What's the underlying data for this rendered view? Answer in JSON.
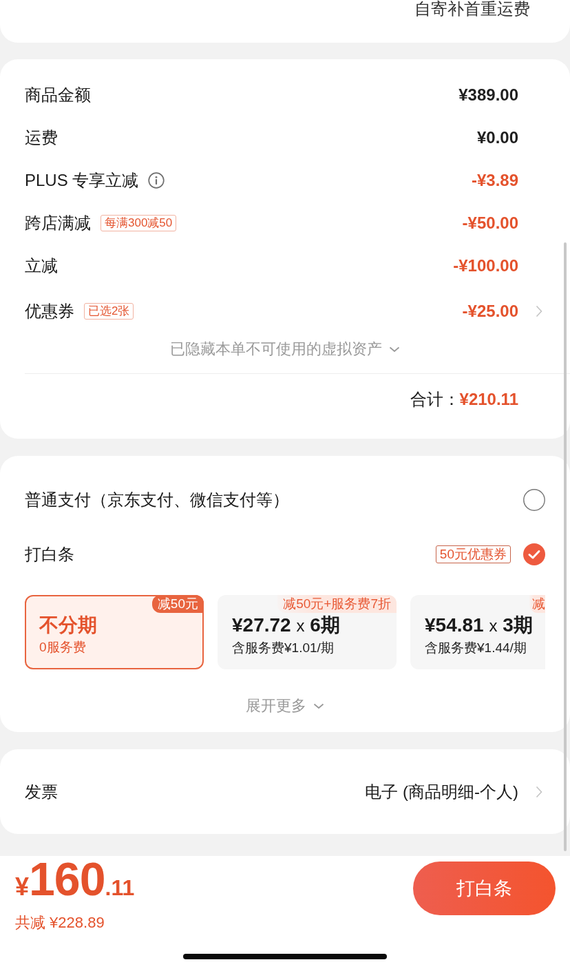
{
  "shipping_note": {
    "text": "自寄补首重运费"
  },
  "summary": {
    "rows": [
      {
        "label": "商品金额",
        "value": "¥389.00",
        "discount": false
      },
      {
        "label": "运费",
        "value": "¥0.00",
        "discount": false
      },
      {
        "label": "PLUS 专享立减",
        "value": "-¥3.89",
        "discount": true,
        "info_icon": true
      },
      {
        "label": "跨店满减",
        "tag": "每满300减50",
        "value": "-¥50.00",
        "discount": true
      },
      {
        "label": "立减",
        "value": "-¥100.00",
        "discount": true
      },
      {
        "label": "优惠券",
        "tag": "已选2张",
        "value": "-¥25.00",
        "discount": true,
        "chevron": true
      }
    ],
    "hidden_assets": "已隐藏本单不可使用的虚拟资产",
    "total": {
      "label": "合计：",
      "value": "¥210.11"
    }
  },
  "payment": {
    "options": [
      {
        "label": "普通支付（京东支付、微信支付等）",
        "selected": false
      },
      {
        "label": "打白条",
        "tag": "50元优惠券",
        "selected": true
      }
    ],
    "plans": [
      {
        "kind": "full",
        "title": "不分期",
        "subtitle": "0服务费",
        "badge": "减50元",
        "selected": true
      },
      {
        "kind": "installment",
        "amount": "¥27.72",
        "multiplier": "x",
        "periods": "6期",
        "subtitle": "含服务费¥1.01/期",
        "badge": "减50元+服务费7折",
        "selected": false
      },
      {
        "kind": "installment",
        "amount": "¥54.81",
        "multiplier": "x",
        "periods": "3期",
        "subtitle": "含服务费¥1.44/期",
        "badge": "减",
        "selected": false
      }
    ],
    "expand": "展开更多"
  },
  "invoice": {
    "label": "发票",
    "value": "电子 (商品明细-个人)"
  },
  "footer": {
    "price": {
      "symbol": "¥",
      "integer": "160",
      "decimal": ".11"
    },
    "saved": "共减 ¥228.89",
    "button": "打白条"
  }
}
